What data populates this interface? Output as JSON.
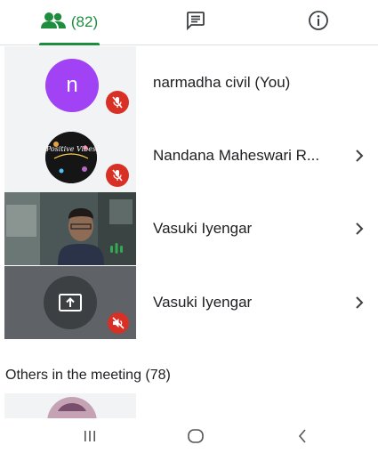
{
  "tabs": {
    "people_count": "(82)",
    "active": "people"
  },
  "participants": [
    {
      "name": "narmadha civil (You)",
      "avatar_letter": "n",
      "avatar_color": "#a142f4",
      "status": "muted"
    },
    {
      "name": "Nandana Maheswari R...",
      "avatar_text": "Positive Vibes",
      "status": "muted"
    },
    {
      "name": "Vasuki Iyengar",
      "status": "speaking"
    },
    {
      "name": "Vasuki Iyengar",
      "status": "presenting-muted"
    }
  ],
  "others_section": {
    "label": "Others in the meeting (78)"
  },
  "colors": {
    "accent": "#1e8e3e",
    "mute": "#d93025",
    "speaking": "#34a853"
  },
  "icons": [
    "people-icon",
    "chat-icon",
    "info-icon",
    "mic-off-icon",
    "volume-off-icon",
    "present-screen-icon",
    "chevron-right-icon",
    "recent-apps-icon",
    "home-icon",
    "back-icon"
  ]
}
